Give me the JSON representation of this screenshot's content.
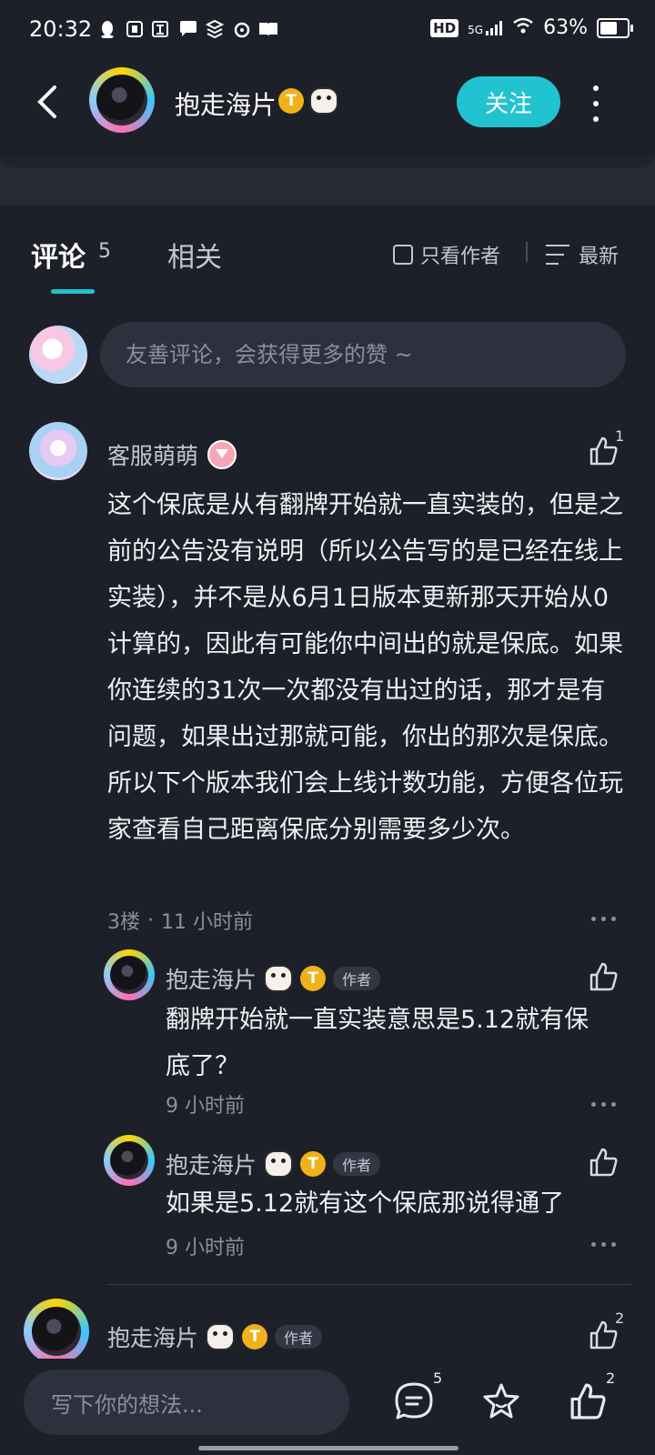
{
  "status_bar": {
    "time": "20:32",
    "network": "5G",
    "battery": "63%",
    "battery_level": 0.63,
    "hd": "HD"
  },
  "header": {
    "username": "抱走海片",
    "follow_label": "关注",
    "badge_letter": "T"
  },
  "tabs": {
    "comments_label": "评论",
    "comments_count": "5",
    "related_label": "相关",
    "author_only_label": "只看作者",
    "sort_label": "最新"
  },
  "comment_input": {
    "placeholder": "友善评论，会获得更多的赞 ~"
  },
  "comments": [
    {
      "username": "客服萌萌",
      "likes": "1",
      "text": "这个保底是从有翻牌开始就一直实装的，但是之前的公告没有说明（所以公告写的是已经在线上实装），并不是从6月1日版本更新那天开始从0计算的，因此有可能你中间出的就是保底。如果你连续的31次一次都没有出过的话，那才是有问题，如果出过那就可能，你出的那次是保底。所以下个版本我们会上线计数功能，方便各位玩家查看自己距离保底分别需要多少次。",
      "floor": "3楼",
      "dot": "·",
      "time": "11 小时前",
      "replies": [
        {
          "username": "抱走海片",
          "author_tag": "作者",
          "text": "翻牌开始就一直实装意思是5.12就有保底了？",
          "time": "9 小时前"
        },
        {
          "username": "抱走海片",
          "author_tag": "作者",
          "text": "如果是5.12就有这个保底那说得通了",
          "time": "9 小时前"
        }
      ]
    },
    {
      "username": "抱走海片",
      "author_tag": "作者",
      "likes": "2"
    }
  ],
  "bottom_bar": {
    "placeholder": "写下你的想法...",
    "comment_count": "5",
    "like_count": "2"
  },
  "colors": {
    "accent": "#21c3d0",
    "background": "#1e2029",
    "input_bg": "#2d313d",
    "badge_gold": "#f0b21b"
  }
}
